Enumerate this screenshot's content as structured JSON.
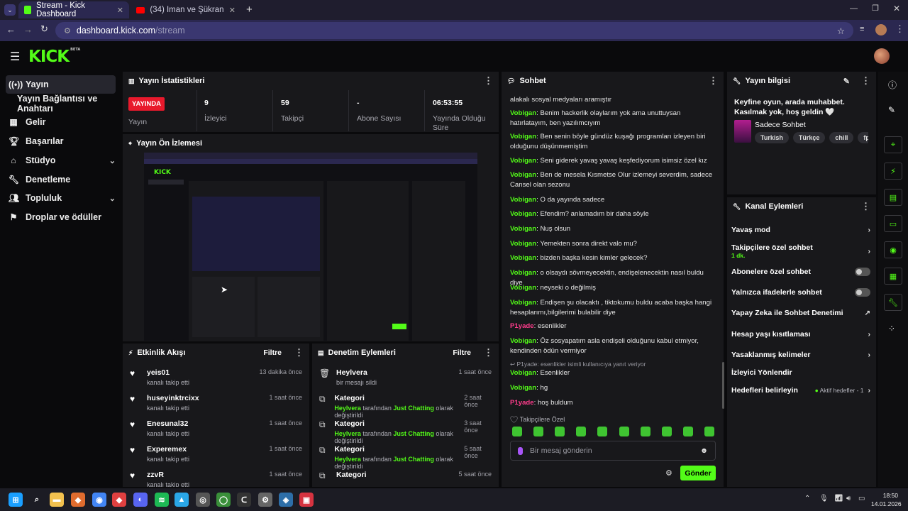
{
  "browser": {
    "tabs": [
      {
        "title": "Stream - Kick Dashboard",
        "active": true
      },
      {
        "title": "(34) İman ve Şükran'ın Tartışma",
        "active": false
      }
    ],
    "url_host": "dashboard.kick.com",
    "url_path": "/stream"
  },
  "app": {
    "logo": "KICK",
    "logo_badge": "BETA"
  },
  "sidebar": {
    "items": [
      {
        "label": "Yayın",
        "icon": "broadcast-icon"
      },
      {
        "label": "Yayın Bağlantısı ve Anahtarı",
        "icon": ""
      },
      {
        "label": "Gelir",
        "icon": "revenue-icon"
      },
      {
        "label": "Başarılar",
        "icon": "trophy-icon"
      },
      {
        "label": "Stüdyo",
        "icon": "studio-icon"
      },
      {
        "label": "Denetleme",
        "icon": "wrench-icon"
      },
      {
        "label": "Topluluk",
        "icon": "community-icon"
      },
      {
        "label": "Droplar ve ödüller",
        "icon": "drops-icon"
      }
    ]
  },
  "stats": {
    "title": "Yayın İstatistikleri",
    "live_badge": "YAYINDA",
    "live_label": "Yayın",
    "viewers_value": "9",
    "viewers_label": "İzleyici",
    "followers_value": "59",
    "followers_label": "Takipçi",
    "subs_value": "-",
    "subs_label": "Abone Sayısı",
    "uptime_value": "06:53:55",
    "uptime_label": "Yayında Olduğu Süre"
  },
  "preview": {
    "title": "Yayın Ön İzlemesi"
  },
  "activity": {
    "title": "Etkinlik Akışı",
    "filter": "Filtre",
    "items": [
      {
        "name": "yeis01",
        "sub": "kanalı takip etti",
        "time": "13 dakika önce"
      },
      {
        "name": "huseyinktrcixx",
        "sub": "kanalı takip etti",
        "time": "1 saat önce"
      },
      {
        "name": "Enesunal32",
        "sub": "kanalı takip etti",
        "time": "1 saat önce"
      },
      {
        "name": "Experemex",
        "sub": "kanalı takip etti",
        "time": "1 saat önce"
      },
      {
        "name": "zzvR",
        "sub": "kanalı takip etti",
        "time": "1 saat önce"
      }
    ]
  },
  "modlog": {
    "title": "Denetim Eylemleri",
    "filter": "Filtre",
    "first": {
      "name": "Heylvera",
      "sub": "bir mesajı sildi",
      "time": "1 saat önce"
    },
    "items": [
      {
        "name": "Kategori",
        "by": "Heylvera",
        "mid": " tarafından ",
        "cat": "Just Chatting",
        "end": " olarak değiştirildi",
        "time": "2 saat önce"
      },
      {
        "name": "Kategori",
        "by": "Heylvera",
        "mid": " tarafından ",
        "cat": "Just Chatting",
        "end": " olarak değiştirildi",
        "time": "3 saat önce"
      },
      {
        "name": "Kategori",
        "by": "Heylvera",
        "mid": " tarafından ",
        "cat": "Just Chatting",
        "end": " olarak değiştirildi",
        "time": "5 saat önce"
      },
      {
        "name": "Kategori",
        "by": "",
        "mid": "",
        "cat": "",
        "end": "",
        "time": "5 saat önce"
      }
    ]
  },
  "chat": {
    "title": "Sohbet",
    "partial_top": "alakalı sosyal medyaları aramıştır",
    "messages": [
      {
        "user": "Vobigan",
        "text": "Benim hackerlik olaylarım yok ama unuttuysan hatırlatayım, ben yazılımcıyım",
        "pink": false
      },
      {
        "user": "Vobigan",
        "text": "Ben senin böyle gündüz kuşağı programları izleyen biri olduğunu düşünmemiştim",
        "pink": false
      },
      {
        "user": "Vobigan",
        "text": "Seni giderek yavaş yavaş keşfediyorum isimsiz özel kız",
        "pink": false
      },
      {
        "user": "Vobigan",
        "text": "Ben de mesela Kısmetse Olur izlemeyi severdim, sadece Cansel olan sezonu",
        "pink": false
      },
      {
        "user": "Vobigan",
        "text": "O da yayında sadece",
        "pink": false
      },
      {
        "user": "Vobigan",
        "text": "Efendim? anlamadım bir daha söyle",
        "pink": false
      },
      {
        "user": "Vobigan",
        "text": "Nuş olsun",
        "pink": false
      },
      {
        "user": "Vobigan",
        "text": "Yemekten sonra direkt valo mu?",
        "pink": false
      },
      {
        "user": "Vobigan",
        "text": "bizden başka kesin kimler gelecek?",
        "pink": false
      },
      {
        "user": "Vobigan",
        "text": "o olsaydı sövmeyecektin, endişelenecektin nasıl buldu diye",
        "pink": false
      },
      {
        "user": "Vobigan",
        "text": "neyseki o değilmiş",
        "pink": false
      },
      {
        "user": "Vobigan",
        "text": "Endişen şu olacaktı , tiktokumu buldu acaba başka hangi hesaplarımı,bilgilerimi bulabilir diye",
        "pink": false
      },
      {
        "user": "P1yade",
        "text": "esenlikler",
        "pink": true
      },
      {
        "user": "Vobigan",
        "text": "Öz sosyapatım asla endişeli olduğunu kabul etmiyor, kendinden ödün vermiyor",
        "pink": false
      }
    ],
    "reply_note": "P1yade: esenlikler isimli kullanıcıya yanıt veriyor",
    "tail": [
      {
        "user": "Vobigan",
        "text": "Esenlikler",
        "pink": false
      },
      {
        "user": "Vobigan",
        "text": "hg",
        "pink": false
      },
      {
        "user": "P1yade",
        "text": "hoş buldum",
        "pink": true
      }
    ],
    "followers_only_label": "Takipçilere Özel",
    "input_placeholder": "Bir mesaj gönderin",
    "send_label": "Gönder"
  },
  "stream_info": {
    "title": "Yayın bilgisi",
    "stream_title": "Keyfine oyun, arada muhabbet. Kasılmak yok, hoş geldin 🤍",
    "category": "Sadece Sohbet",
    "tags": [
      "Turkish",
      "Türkçe",
      "chill",
      "fps",
      "fu"
    ]
  },
  "channel_actions": {
    "title": "Kanal Eylemleri",
    "slow_mode": "Yavaş mod",
    "followers_only": "Takipçilere özel sohbet",
    "followers_only_sub": "1 dk.",
    "subs_only": "Abonelere özel sohbet",
    "emotes_only": "Yalnızca ifadelerle sohbet",
    "ai_mod": "Yapay Zeka ile Sohbet Denetimi",
    "account_age": "Hesap yaşı kısıtlaması",
    "banned_words": "Yasaklanmış kelimeler",
    "viewer_director": "İzleyici Yönlendir",
    "goals": "Hedefleri belirleyin",
    "goals_status": "Aktif hedefler - 1"
  },
  "taskbar": {
    "time": "18:50",
    "date": "14.01.2026"
  },
  "colors": {
    "accent": "#53fc18",
    "live": "#e8192c",
    "panel": "#18181b",
    "page": "#0a0a0c"
  }
}
